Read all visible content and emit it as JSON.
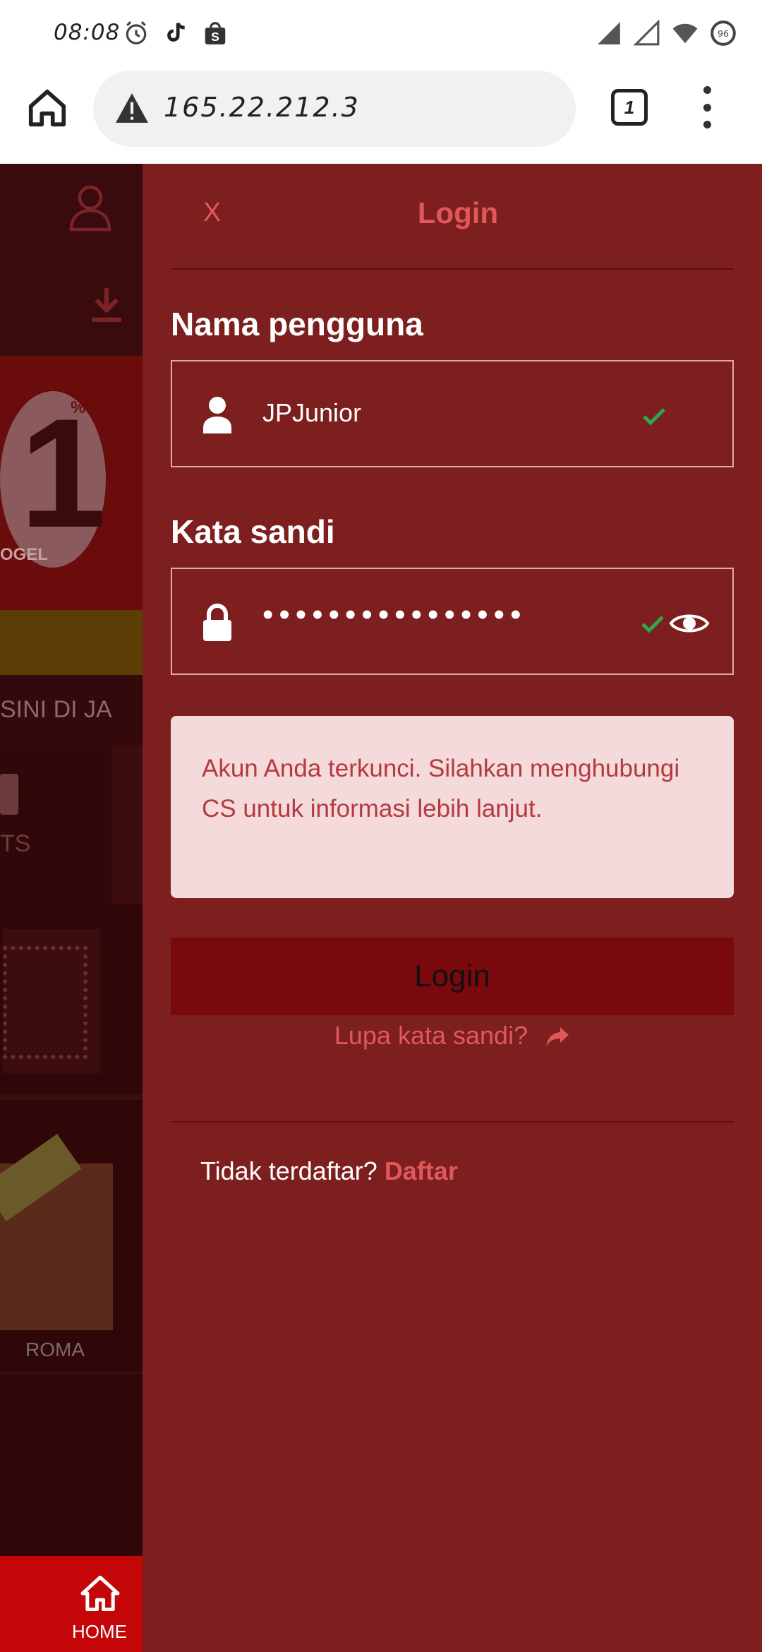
{
  "status_bar": {
    "time": "08:08",
    "icons_left": [
      "alarm-icon",
      "tiktok-icon",
      "shop-icon"
    ],
    "icons_right": [
      "signal-icon",
      "signal-empty-icon",
      "wifi-icon",
      "battery-icon"
    ],
    "battery": "96"
  },
  "browser": {
    "url": "165.22.212.3",
    "tab_count": "1",
    "icons": [
      "home-icon",
      "warning-icon",
      "tabs-icon",
      "more-vert-icon"
    ]
  },
  "background_page": {
    "banner_number": "1",
    "banner_percent": "%",
    "banner_tag": "OGEL",
    "marquee": "SINI DI JA",
    "category_label": "TS",
    "game_label": "ROMA",
    "nav_home": "HOME"
  },
  "login": {
    "close_label": "X",
    "title": "Login",
    "username_label": "Nama pengguna",
    "username_value": "JPJunior",
    "password_label": "Kata sandi",
    "password_mask": "••••••••••••••••",
    "error_message": "Akun Anda terkunci. Silahkan menghubungi CS untuk informasi lebih lanjut.",
    "login_button": "Login",
    "forgot_password": "Lupa kata sandi?",
    "register_prompt": "Tidak terdaftar?",
    "register_link": "Daftar"
  },
  "colors": {
    "drawer_bg": "#7d1f1f",
    "accent": "#e0585a",
    "alert_bg": "#f4dadb",
    "alert_text": "#b53a3e",
    "button_bg": "#7a090d",
    "valid_check": "#2fa84f"
  }
}
